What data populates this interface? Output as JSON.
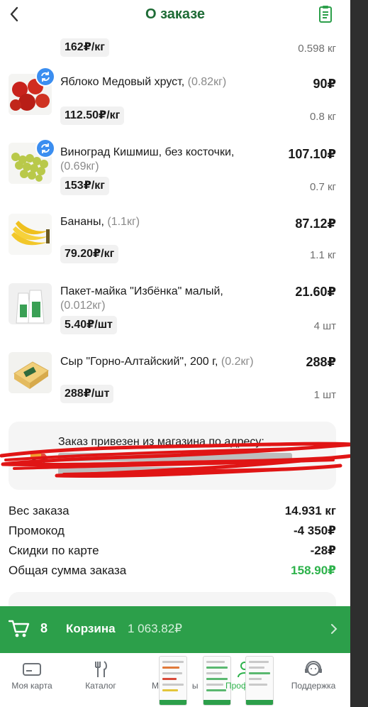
{
  "header": {
    "title": "О заказе"
  },
  "products": [
    {
      "name": "",
      "weight": "",
      "price": "",
      "unit_price": "162₽/кг",
      "qty": "0.598 кг",
      "swapped": false
    },
    {
      "name": "Яблоко Медовый хруст,",
      "weight": "(0.82кг)",
      "price": "90₽",
      "unit_price": "112.50₽/кг",
      "qty": "0.8 кг",
      "swapped": true
    },
    {
      "name": "Виноград Кишмиш, без косточки,",
      "weight": "(0.69кг)",
      "price": "107.10₽",
      "unit_price": "153₽/кг",
      "qty": "0.7 кг",
      "swapped": true
    },
    {
      "name": "Бананы,",
      "weight": "(1.1кг)",
      "price": "87.12₽",
      "unit_price": "79.20₽/кг",
      "qty": "1.1 кг",
      "swapped": false
    },
    {
      "name": "Пакет-майка \"Избёнка\" малый,",
      "weight": "(0.012кг)",
      "price": "21.60₽",
      "unit_price": "5.40₽/шт",
      "qty": "4 шт",
      "swapped": false
    },
    {
      "name": "Сыр \"Горно-Алтайский\", 200 г,",
      "weight": "(0.2кг)",
      "price": "288₽",
      "unit_price": "288₽/шт",
      "qty": "1 шт",
      "swapped": false
    }
  ],
  "address": {
    "title": "Заказ привезен из магазина по адресу:"
  },
  "summary": [
    {
      "label": "Вес заказа",
      "value": "14.931 кг",
      "highlight": false
    },
    {
      "label": "Промокод",
      "value": "-4 350₽",
      "highlight": false
    },
    {
      "label": "Скидки по карте",
      "value": "-28₽",
      "highlight": false
    },
    {
      "label": "Общая сумма заказа",
      "value": "158.90₽",
      "highlight": true
    }
  ],
  "cart": {
    "count": "8",
    "label": "Корзина",
    "total": "1 063.82₽"
  },
  "nav": [
    {
      "label": "Моя карта",
      "icon": "card-icon",
      "active": false
    },
    {
      "label": "Каталог",
      "icon": "fork-knife-icon",
      "active": false
    },
    {
      "label": "Ма",
      "label_tail": "ы",
      "icon": "shop-icon",
      "active": false
    },
    {
      "label": "Проф",
      "label_tail": "ль",
      "icon": "profile-icon",
      "active": true
    },
    {
      "label": "Поддержка",
      "icon": "support-icon",
      "active": false
    }
  ],
  "colors": {
    "brand_green": "#2c9f4a",
    "title_green": "#1d6b35",
    "total_green": "#2db24b",
    "swap_blue": "#3b8ef0"
  }
}
